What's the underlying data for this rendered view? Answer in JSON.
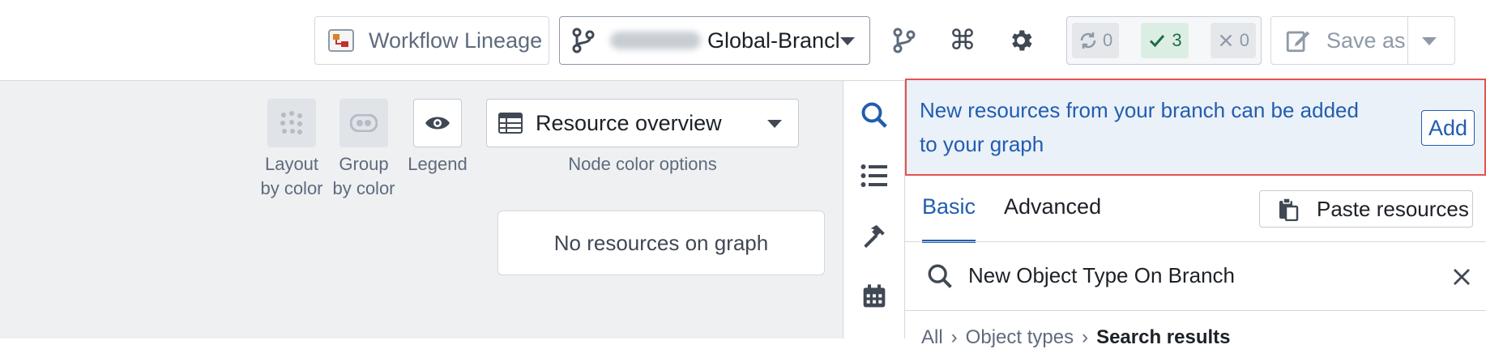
{
  "header": {
    "lineage_label": "Workflow Lineage",
    "branch_label": "Global-Brancl",
    "checks": {
      "running": "0",
      "passed": "3",
      "failed": "0"
    },
    "save_as_label": "Save as"
  },
  "toolbar": {
    "layout_label_1": "Layout",
    "layout_label_2": "by color",
    "group_label_1": "Group",
    "group_label_2": "by color",
    "legend_label": "Legend",
    "resource_select_value": "Resource overview",
    "node_color_options_label": "Node color options"
  },
  "canvas": {
    "empty_message": "No resources on graph"
  },
  "panel": {
    "callout_text": "New resources from your branch can be added to your graph",
    "add_label": "Add",
    "tabs": [
      {
        "label": "Basic"
      },
      {
        "label": "Advanced"
      }
    ],
    "paste_label": "Paste resources",
    "search_value": "New Object Type On Branch",
    "breadcrumbs": [
      "All",
      "Object types",
      "Search results"
    ]
  },
  "icons": {
    "lineage": "workflow-lineage-icon",
    "branch": "git-branch-icon",
    "command": "command-icon",
    "settings": "gear-icon",
    "refresh": "refresh-icon",
    "check": "check-icon",
    "cross": "cross-icon",
    "edit": "edit-icon",
    "layout": "grid-dots-icon",
    "group": "group-icon",
    "legend": "eye-icon",
    "table": "table-icon",
    "search": "search-icon",
    "list": "list-icon",
    "hammer": "hammer-icon",
    "calendar": "calendar-icon",
    "clipboard": "clipboard-icon",
    "close": "close-icon",
    "chevron": "chevron-right-icon"
  },
  "colors": {
    "accent": "#215db0",
    "highlight_border": "#e5534b",
    "callout_bg": "#ebf1f9",
    "success": "#1c6e42"
  }
}
